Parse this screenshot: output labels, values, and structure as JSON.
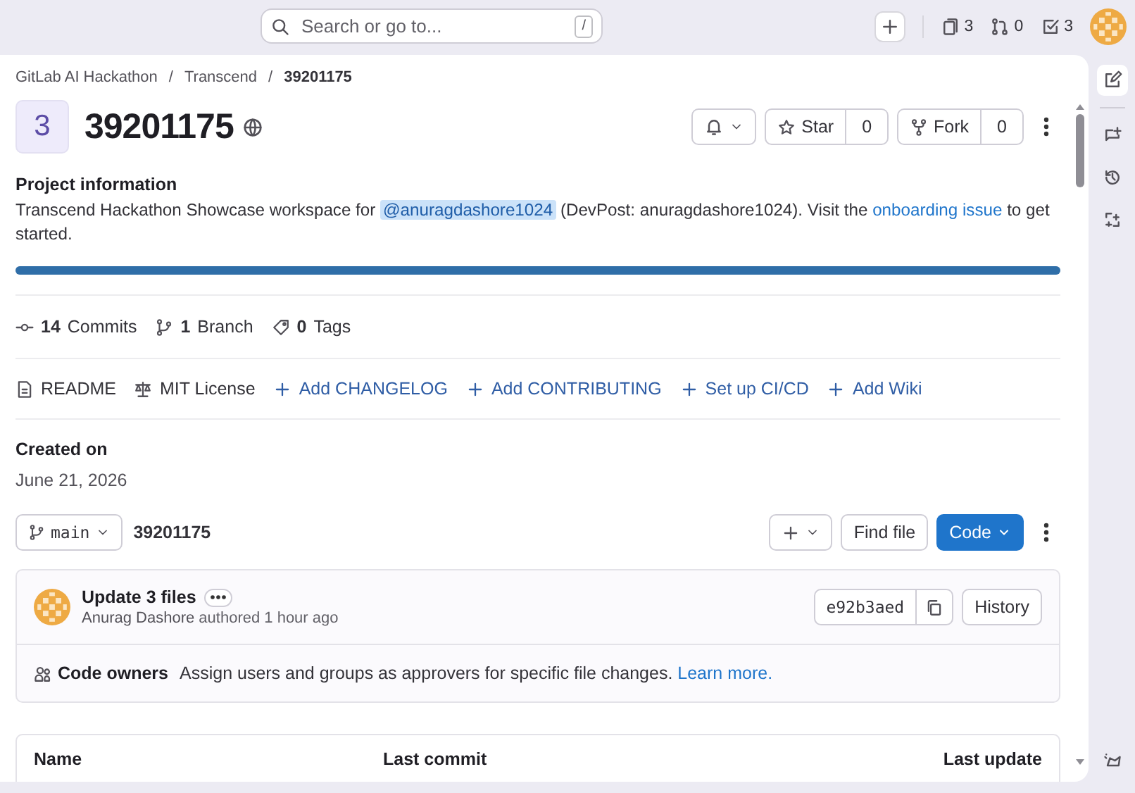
{
  "top_bar": {
    "search": {
      "placeholder": "Search or go to...",
      "shortcut": "/"
    },
    "counters": [
      {
        "kind": "issues",
        "count": "3"
      },
      {
        "kind": "merge",
        "count": "0"
      },
      {
        "kind": "todo",
        "count": "3"
      }
    ]
  },
  "breadcrumbs": [
    {
      "label": "GitLab AI Hackathon",
      "separator": "/"
    },
    {
      "label": "Transcend",
      "separator": "/"
    },
    {
      "label": "39201175"
    }
  ],
  "project": {
    "avatar_letter": "3",
    "name": "39201175",
    "star": {
      "label": "Star",
      "count": "0"
    },
    "fork": {
      "label": "Fork",
      "count": "0"
    }
  },
  "info": {
    "heading": "Project information",
    "description": [
      {
        "kind": "text",
        "text": "Transcend Hackathon Showcase workspace for "
      },
      {
        "kind": "mention",
        "text": "@anuragdashore1024"
      },
      {
        "kind": "text",
        "text": " (DevPost: anuragdashore1024). Visit the "
      },
      {
        "kind": "link",
        "text": "onboarding issue"
      },
      {
        "kind": "text",
        "text": " to get started."
      }
    ]
  },
  "language_bar": {
    "level": 1
  },
  "stats": [
    {
      "kind": "commits",
      "count": "14",
      "label": "Commits"
    },
    {
      "kind": "branches",
      "count": "1",
      "label": "Branch"
    },
    {
      "kind": "tags",
      "count": "0",
      "label": "Tags"
    }
  ],
  "quick_links": [
    {
      "kind": "readme",
      "label": "README"
    },
    {
      "kind": "license",
      "label": "MIT License"
    },
    {
      "kind": "add",
      "label": "Add CHANGELOG"
    },
    {
      "kind": "add",
      "label": "Add CONTRIBUTING"
    },
    {
      "kind": "add",
      "label": "Set up CI/CD"
    },
    {
      "kind": "add",
      "label": "Add Wiki"
    }
  ],
  "created": {
    "heading": "Created on",
    "date": "June 21, 2026"
  },
  "repo_bar": {
    "branch": "main",
    "path": "39201175",
    "find_file": "Find file",
    "code": "Code"
  },
  "last_commit": {
    "title": "Update 3 files",
    "author": "Anurag Dashore",
    "meta": " authored 1 hour ago",
    "sha": "e92b3aed",
    "history": "History"
  },
  "code_owners": {
    "label": "Code owners",
    "text": "Assign users and groups as approvers for specific file changes. ",
    "link": "Learn more."
  },
  "table": {
    "columns": [
      "Name",
      "Last commit",
      "Last update"
    ]
  }
}
